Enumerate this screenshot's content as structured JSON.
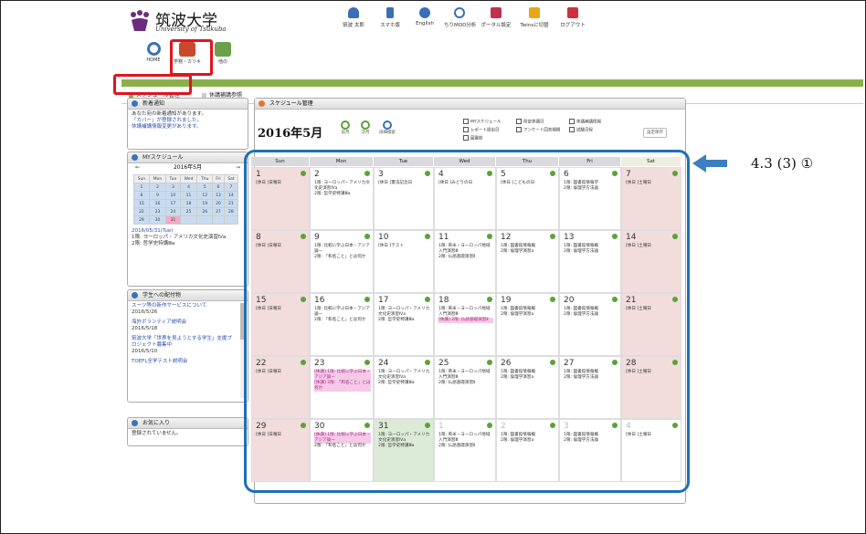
{
  "header": {
    "university": "筑波大学",
    "university_en": "University of Tsukuba",
    "user": "筑波 太郎",
    "nav": [
      "スマホ版",
      "English",
      "ちりMOD分析",
      "ポータル設定",
      "Twinsに切替",
      "ログアウト"
    ],
    "nav_colors": [
      "#3a6fb5",
      "#3a6fb5",
      "#3a6fb5",
      "#3a6fb5",
      "#c23050",
      "#e6a817",
      "#d12f3f"
    ]
  },
  "apps": [
    {
      "label": "HOME",
      "icon": "home-icon",
      "color": "#3a73b8"
    },
    {
      "label": "学務・カリキ",
      "icon": "book-icon",
      "color": "#c84a2b"
    },
    {
      "label": "他の",
      "icon": "folder-icon",
      "color": "#6aa04a"
    }
  ],
  "subnav": {
    "tabs": [
      "スケジュール管理",
      "休講補講参照"
    ]
  },
  "sidebar": {
    "notices": {
      "title": "新着通知",
      "lines": [
        "あなた宛の新着通知があります。",
        "「カバー」が登録されました。",
        "休講補講情報変更があります。"
      ]
    },
    "my_schedule": {
      "title": "MYスケジュール",
      "month": "2016年5月",
      "weekdays": [
        "Sun",
        "Mon",
        "Tue",
        "Wed",
        "Thu",
        "Fri",
        "Sat"
      ],
      "weeks": [
        [
          "1",
          "2",
          "3",
          "4",
          "5",
          "6",
          "7"
        ],
        [
          "8",
          "9",
          "10",
          "11",
          "12",
          "13",
          "14"
        ],
        [
          "15",
          "16",
          "17",
          "18",
          "19",
          "20",
          "21"
        ],
        [
          "22",
          "23",
          "24",
          "25",
          "26",
          "27",
          "28"
        ],
        [
          "29",
          "30",
          "31",
          "",
          "",
          "",
          ""
        ]
      ],
      "selected_date": "2016/05/31(Tue)",
      "events": [
        "1限: ヨーロッパ・アメリカ文化史演習Ⅳa",
        "2限: 哲学史特講Ⅲa"
      ]
    },
    "announcements": {
      "title": "学生への配付物",
      "items": [
        {
          "text": "スーツ等の新作サービスについて",
          "date": "2016/5/26"
        },
        {
          "text": "海外ボランティア説明会",
          "date": "2016/5/18"
        },
        {
          "text": "筑波大学「世界を見ようとする学生」支援プロジェクト募集中",
          "date": "2016/5/10"
        },
        {
          "text": "TOEFL全学テスト説明会",
          "date": ""
        }
      ]
    },
    "sites": {
      "title": "お気に入り",
      "empty": "登録されていません。"
    }
  },
  "main": {
    "title": "スケジュール管理",
    "month": "2016年5月",
    "nav": [
      "前月",
      "次月",
      "詳細検索"
    ],
    "filters": [
      "MYスケジュール",
      "所定休講日",
      "休講補講情報",
      "レポート提出日",
      "アンケート回答期間",
      "試験日程",
      "図書館"
    ],
    "settings": "設定保存"
  },
  "calendar": {
    "headers": [
      "Sun",
      "Mon",
      "Tue",
      "Wed",
      "Thu",
      "Fri",
      "Sat"
    ],
    "weeks": [
      [
        {
          "day": "1",
          "events": [
            "[休日 ]日曜日"
          ]
        },
        {
          "day": "2",
          "events": [
            "1限: ヨーロッパ・アメリカ文化史演習Ⅳa",
            "2限: 哲学史特講Ⅲa"
          ]
        },
        {
          "day": "3",
          "events": [
            "[休日 ]憲法記念日"
          ]
        },
        {
          "day": "4",
          "events": [
            "[休日 ]みどりの日"
          ]
        },
        {
          "day": "5",
          "events": [
            "[休日 ]こどもの日"
          ]
        },
        {
          "day": "6",
          "events": [
            "1限: 図書館情報学",
            "2限: 倫理学方法論"
          ]
        },
        {
          "day": "7",
          "events": [
            "[休日 ]土曜日"
          ]
        }
      ],
      [
        {
          "day": "8",
          "events": [
            "[休日 ]日曜日"
          ]
        },
        {
          "day": "9",
          "events": [
            "1限: 比較に学ぶ日本・アジア論ー",
            "2限: 「和名こと」とは何か"
          ]
        },
        {
          "day": "10",
          "events": [
            "[休日 ]テスト"
          ]
        },
        {
          "day": "11",
          "events": [
            "1限: 英米・ヨーロッパ地域入門演習Ⅲ",
            "2限: 仏語基礎演習Ⅱ"
          ]
        },
        {
          "day": "12",
          "events": [
            "1限: 図書館情報概",
            "2限: 倫理学演習a"
          ]
        },
        {
          "day": "13",
          "events": [
            "1限: 図書館情報概",
            "2限: 倫理学方法論"
          ]
        },
        {
          "day": "14",
          "events": [
            "[休日 ]土曜日"
          ]
        }
      ],
      [
        {
          "day": "15",
          "events": [
            "[休日 ]日曜日"
          ]
        },
        {
          "day": "16",
          "events": [
            "1限: 比較に学ぶ日本・アジア論ー",
            "2限: 「和名こと」とは何か"
          ]
        },
        {
          "day": "17",
          "events": [
            "1限: ヨーロッパ・アメリカ文化史演習Ⅳa",
            "2限: 哲学史特講Ⅲa"
          ]
        },
        {
          "day": "18",
          "events": [
            "1限: 英米・ヨーロッパ地域入門演習Ⅲ",
            "[休講] 2限: 仏語基礎演習Ⅱ"
          ]
        },
        {
          "day": "19",
          "events": [
            "1限: 図書館情報概",
            "2限: 倫理学演習a"
          ]
        },
        {
          "day": "20",
          "events": [
            "1限: 図書館情報概",
            "2限: 倫理学方法論"
          ]
        },
        {
          "day": "21",
          "events": [
            "[休日 ]土曜日"
          ]
        }
      ],
      [
        {
          "day": "22",
          "events": [
            "[休日 ]日曜日"
          ]
        },
        {
          "day": "23",
          "events": [
            "[休講] 1限: 比較に学ぶ日本・アジア論ー",
            "[休講] 2限: 「和名こと」とは何か"
          ]
        },
        {
          "day": "24",
          "events": [
            "1限: ヨーロッパ・アメリカ文化史演習Ⅳa",
            "2限: 哲学史特講Ⅲa"
          ]
        },
        {
          "day": "25",
          "events": [
            "1限: 英米・ヨーロッパ地域入門演習Ⅲ",
            "2限: 仏語基礎演習Ⅱ"
          ]
        },
        {
          "day": "26",
          "events": [
            "1限: 図書館情報概",
            "2限: 倫理学演習a"
          ]
        },
        {
          "day": "27",
          "events": [
            "1限: 図書館情報概",
            "2限: 倫理学方法論"
          ]
        },
        {
          "day": "28",
          "events": [
            "[休日 ]土曜日"
          ]
        }
      ],
      [
        {
          "day": "29",
          "events": [
            "[休日 ]日曜日"
          ]
        },
        {
          "day": "30",
          "events": [
            "[休講] 1限: 比較に学ぶ日本・アジア論ー",
            "2限: 「和名こと」とは何か"
          ]
        },
        {
          "day": "31",
          "events": [
            "1限: ヨーロッパ・アメリカ文化史演習Ⅳa",
            "2限: 哲学史特講Ⅲa"
          ]
        },
        {
          "day": "1",
          "events": [
            "1限: 英米・ヨーロッパ地域入門演習Ⅲ",
            "2限: 仏語基礎演習Ⅱ"
          ]
        },
        {
          "day": "2",
          "events": [
            "1限: 図書館情報概",
            "2限: 倫理学演習a"
          ]
        },
        {
          "day": "3",
          "events": [
            "1限: 図書館情報概",
            "2限: 倫理学方法論"
          ]
        },
        {
          "day": "4",
          "events": [
            "[休日 ]土曜日"
          ]
        }
      ]
    ],
    "colors": {
      "weekend": "#f2dcdc",
      "today": "#dcebd7",
      "header": "#d9d9de",
      "sat_header": "#efefdf",
      "other_month": "#ffffff"
    }
  },
  "annotation": {
    "text": "4.3 (3) ①",
    "color": "#1f6fb5",
    "highlight": "#e0141e"
  }
}
